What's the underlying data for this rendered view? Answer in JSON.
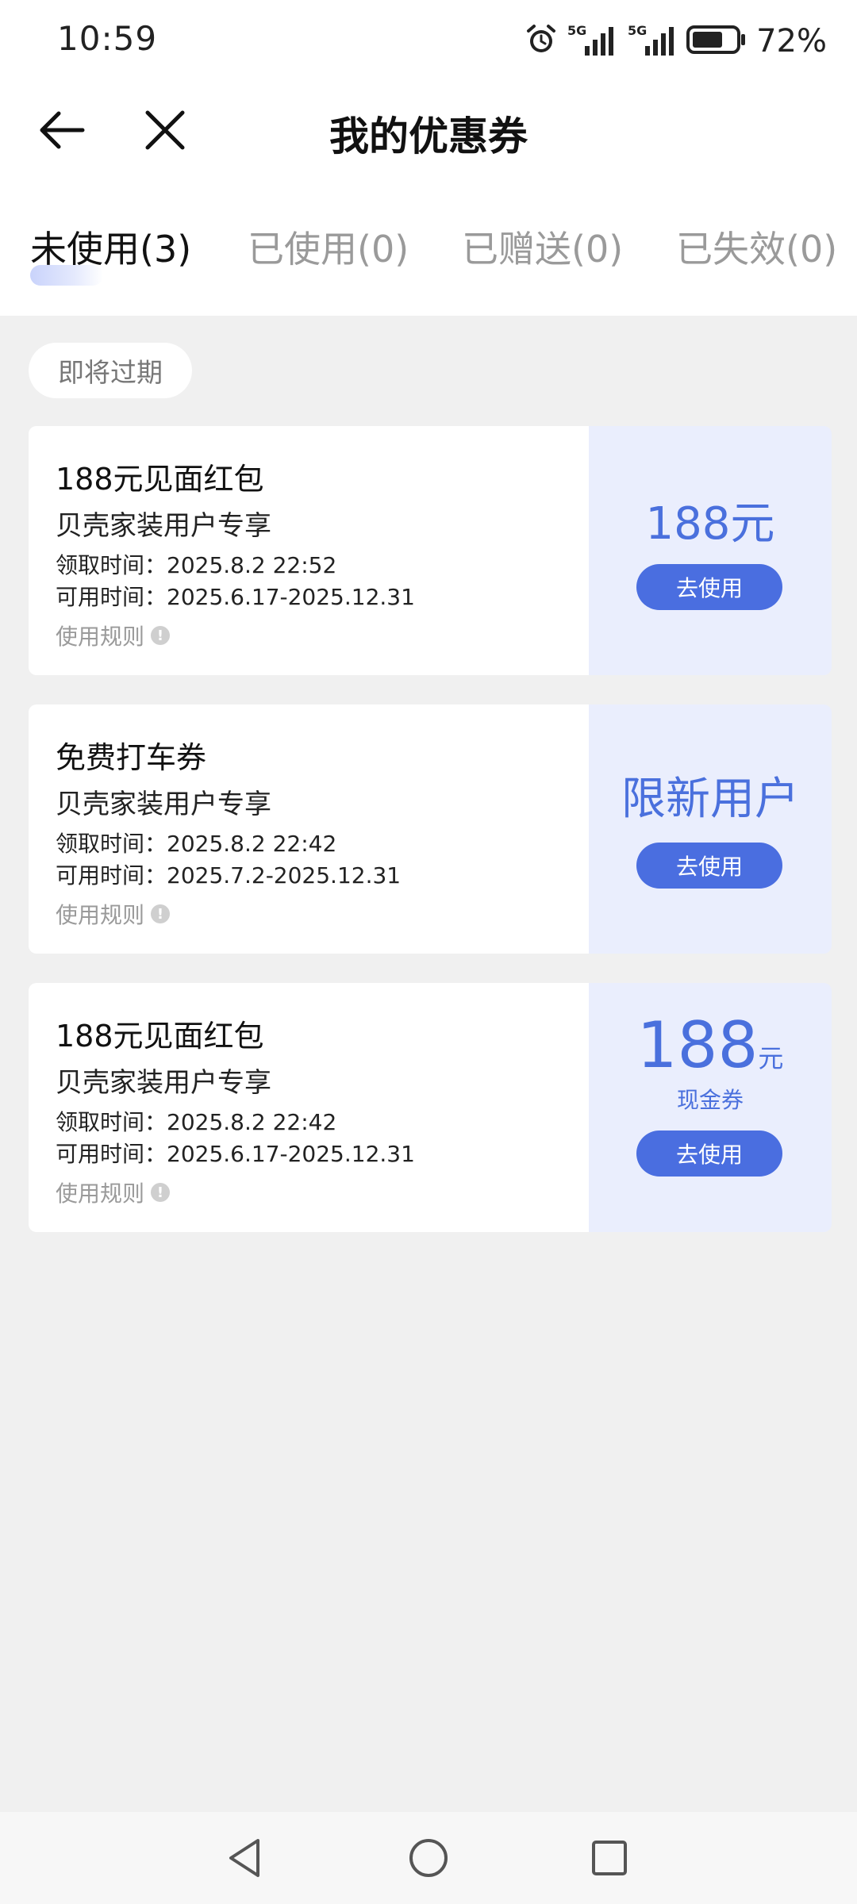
{
  "status_bar": {
    "time": "10:59",
    "network_1": "5G",
    "network_2": "5G",
    "battery_percent": "72%",
    "battery_level": 0.72
  },
  "header": {
    "title": "我的优惠券"
  },
  "tabs": [
    {
      "label": "未使用(3)",
      "active": true
    },
    {
      "label": "已使用(0)",
      "active": false
    },
    {
      "label": "已赠送(0)",
      "active": false
    },
    {
      "label": "已失效(0)",
      "active": false
    }
  ],
  "section": {
    "label": "即将过期"
  },
  "coupons": [
    {
      "title": "188元见面红包",
      "subtitle": "贝壳家装用户专享",
      "received": "领取时间：2025.8.2 22:52",
      "valid": "可用时间：2025.6.17-2025.12.31",
      "rules": "使用规则",
      "value": "188元",
      "button": "去使用"
    },
    {
      "title": "免费打车券",
      "subtitle": "贝壳家装用户专享",
      "received": "领取时间：2025.8.2 22:42",
      "valid": "可用时间：2025.7.2-2025.12.31",
      "rules": "使用规则",
      "value": "限新用户",
      "button": "去使用"
    },
    {
      "title": "188元见面红包",
      "subtitle": "贝壳家装用户专享",
      "received": "领取时间：2025.8.2 22:42",
      "valid": "可用时间：2025.6.17-2025.12.31",
      "rules": "使用规则",
      "value_number": "188",
      "value_unit": "元",
      "value_label": "现金券",
      "button": "去使用"
    }
  ],
  "colors": {
    "accent": "#4a6ee0",
    "accent_text": "#4a70dd",
    "coupon_right_bg": "#eaeefd",
    "page_bg": "#f0f0f0"
  }
}
